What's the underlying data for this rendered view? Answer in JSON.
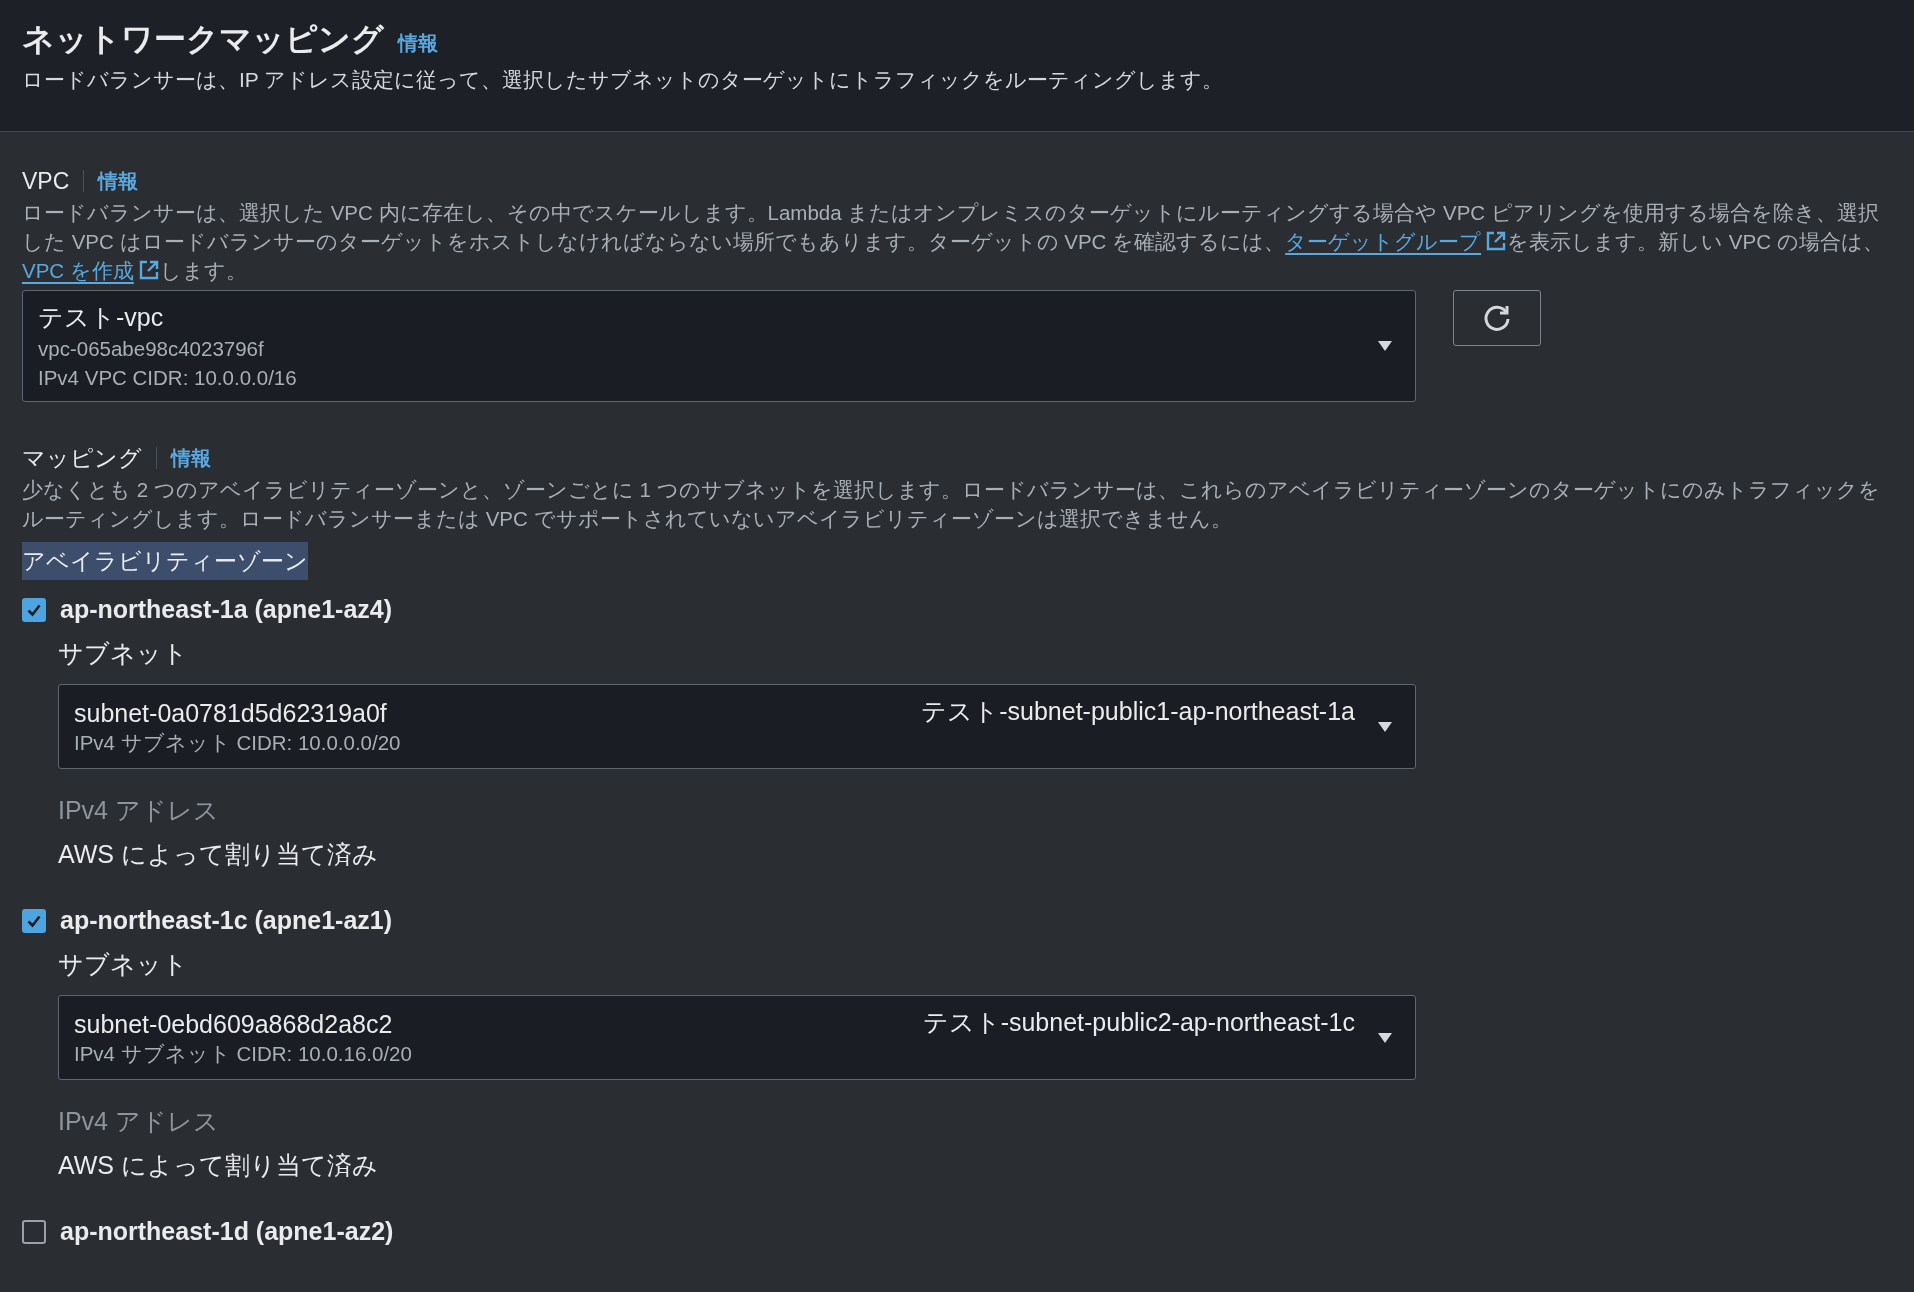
{
  "header": {
    "title": "ネットワークマッピング",
    "info": "情報",
    "description": "ロードバランサーは、IP アドレス設定に従って、選択したサブネットのターゲットにトラフィックをルーティングします。"
  },
  "vpc": {
    "label": "VPC",
    "info": "情報",
    "description": [
      {
        "kind": "text",
        "text": "ロードバランサーは、選択した VPC 内に存在し、その中でスケールします。Lambda またはオンプレミスのターゲットにルーティングする場合や VPC ピアリングを使用する場合を除き、選択した VPC はロードバランサーのターゲットをホストしなければならない場所でもあります。ターゲットの VPC を確認するには、"
      },
      {
        "kind": "link",
        "text": "ターゲットグループ"
      },
      {
        "kind": "text",
        "text": "を表示します。新しい VPC の場合は、"
      },
      {
        "kind": "link",
        "text": "VPC を作成"
      },
      {
        "kind": "text",
        "text": "します。"
      }
    ],
    "select": {
      "name": "テスト-vpc",
      "id": "vpc-065abe98c4023796f",
      "cidr": "IPv4 VPC CIDR: 10.0.0.0/16"
    }
  },
  "mapping": {
    "label": "マッピング",
    "info": "情報",
    "description": "少なくとも 2 つのアベイラビリティーゾーンと、ゾーンごとに 1 つのサブネットを選択します。ロードバランサーは、これらのアベイラビリティーゾーンのターゲットにのみトラフィックをルーティングします。ロードバランサーまたは VPC でサポートされていないアベイラビリティーゾーンは選択できません。",
    "zones_heading": "アベイラビリティーゾーン",
    "zones": [
      {
        "label": "ap-northeast-1a (apne1-az4)",
        "checked": true,
        "subnet_label": "サブネット",
        "subnet": {
          "id": "subnet-0a0781d5d62319a0f",
          "cidr": "IPv4 サブネット CIDR: 10.0.0.0/20",
          "name": "テスト-subnet-public1-ap-northeast-1a"
        },
        "ipv4_label": "IPv4 アドレス",
        "ipv4_value": "AWS によって割り当て済み"
      },
      {
        "label": "ap-northeast-1c (apne1-az1)",
        "checked": true,
        "subnet_label": "サブネット",
        "subnet": {
          "id": "subnet-0ebd609a868d2a8c2",
          "cidr": "IPv4 サブネット CIDR: 10.0.16.0/20",
          "name": "テスト-subnet-public2-ap-northeast-1c"
        },
        "ipv4_label": "IPv4 アドレス",
        "ipv4_value": "AWS によって割り当て済み"
      },
      {
        "label": "ap-northeast-1d (apne1-az2)",
        "checked": false
      }
    ]
  }
}
